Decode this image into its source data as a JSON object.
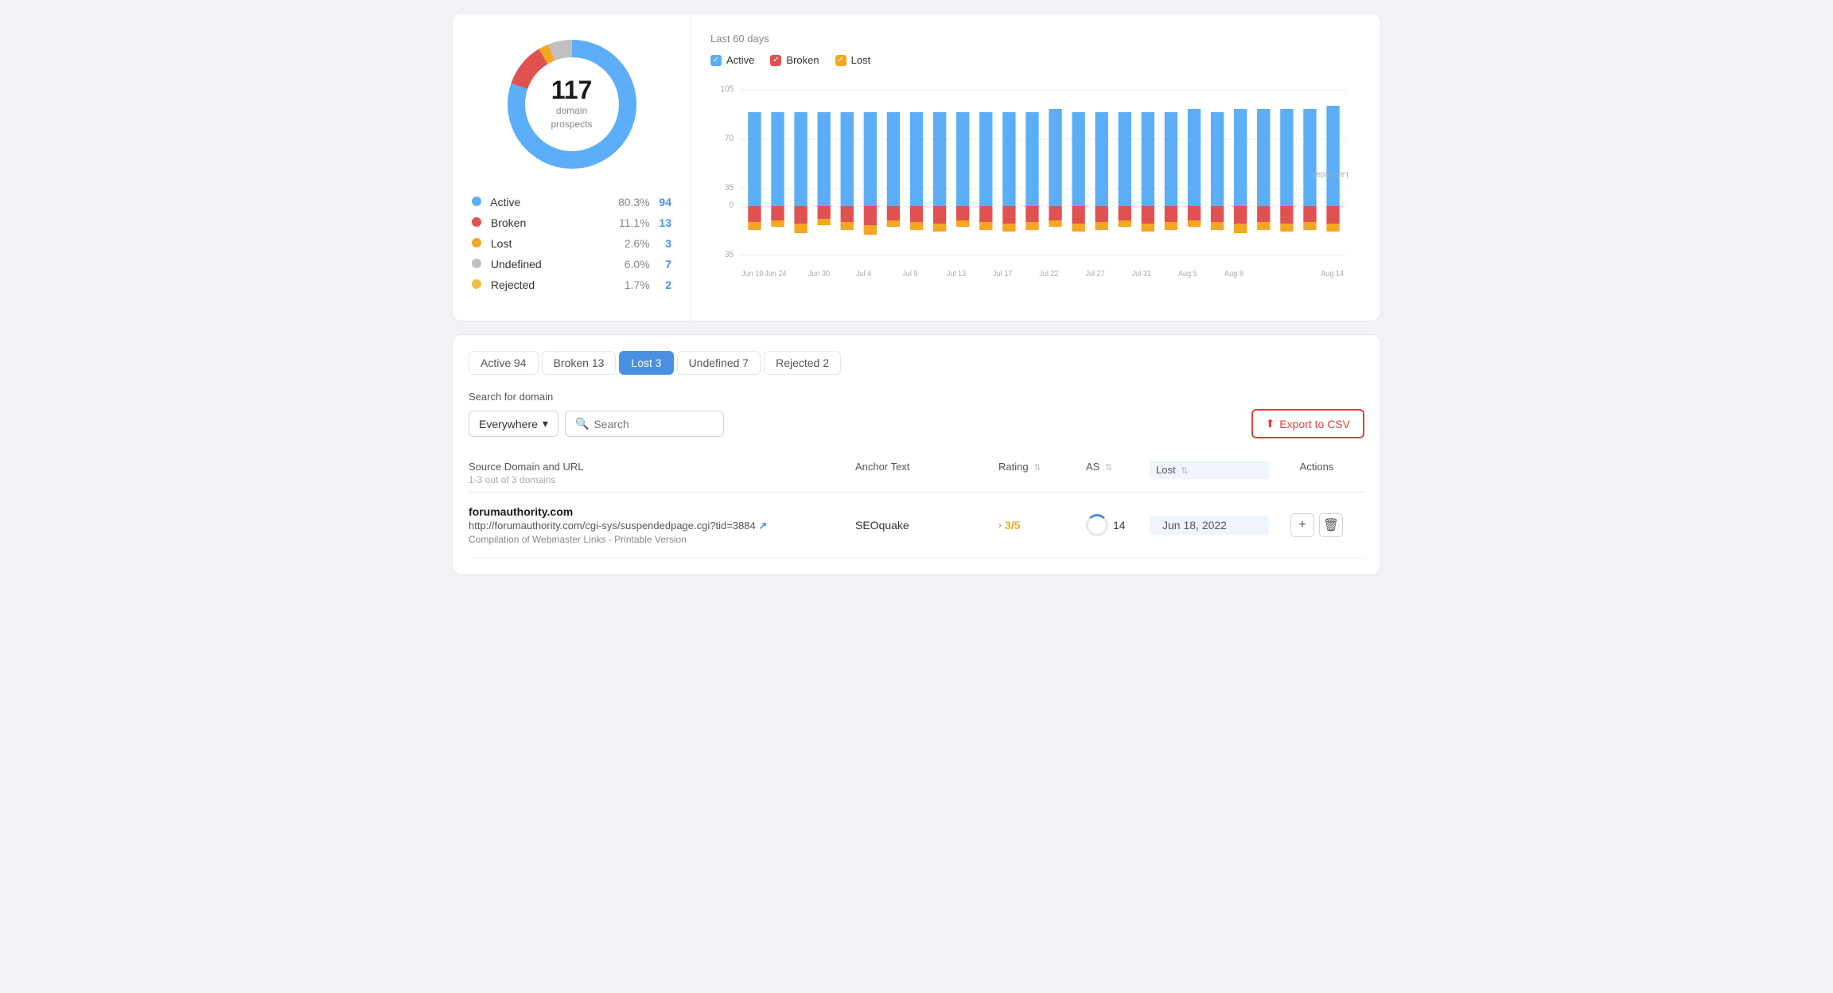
{
  "stats": {
    "total": "117",
    "label": "domain\nprospects",
    "chart_period": "Last 60 days"
  },
  "legend": [
    {
      "name": "Active",
      "color": "#5baef7",
      "pct": "80.3%",
      "count": "94"
    },
    {
      "name": "Broken",
      "color": "#e05252",
      "pct": "11.1%",
      "count": "13"
    },
    {
      "name": "Lost",
      "color": "#f5a623",
      "pct": "2.6%",
      "count": "3"
    },
    {
      "name": "Undefined",
      "color": "#c0c0c0",
      "pct": "6.0%",
      "count": "7"
    },
    {
      "name": "Rejected",
      "color": "#f0c040",
      "pct": "1.7%",
      "count": "2"
    }
  ],
  "chart": {
    "legend": [
      {
        "label": "Active",
        "color": "#5baef7"
      },
      {
        "label": "Broken",
        "color": "#e05252"
      },
      {
        "label": "Lost",
        "color": "#f5a623"
      }
    ],
    "x_labels": [
      "Jun 19",
      "Jun 24",
      "Jun 30",
      "Jul 4",
      "Jul 9",
      "Jul 13",
      "Jul 17",
      "Jul 22",
      "Jul 27",
      "Jul 31",
      "Aug 5",
      "Aug 8",
      "Aug 14"
    ],
    "y_labels": [
      "105",
      "70",
      "35",
      "0",
      "35"
    ],
    "side_label": "Last update"
  },
  "tabs": [
    {
      "label": "Active",
      "count": "94",
      "active": false
    },
    {
      "label": "Broken",
      "count": "13",
      "active": false
    },
    {
      "label": "Lost",
      "count": "3",
      "active": true
    },
    {
      "label": "Undefined",
      "count": "7",
      "active": false
    },
    {
      "label": "Rejected",
      "count": "2",
      "active": false
    }
  ],
  "search": {
    "label": "Search for domain",
    "dropdown_value": "Everywhere",
    "placeholder": "Search",
    "export_btn": "Export to CSV"
  },
  "table": {
    "headers": {
      "source": "Source Domain and URL",
      "source_sub": "1-3 out of 3 domains",
      "anchor": "Anchor Text",
      "rating": "Rating",
      "as": "AS",
      "lost": "Lost",
      "actions": "Actions"
    },
    "rows": [
      {
        "domain": "forumauthority.com",
        "url": "http://forumauthority.com/cgi-sys/suspendedpage.cgi?tid=3884",
        "desc": "Compilation of Webmaster Links - Printable Version",
        "anchor": "SEOquake",
        "rating": "3/5",
        "as": "14",
        "lost": "Jun 18, 2022"
      }
    ]
  }
}
